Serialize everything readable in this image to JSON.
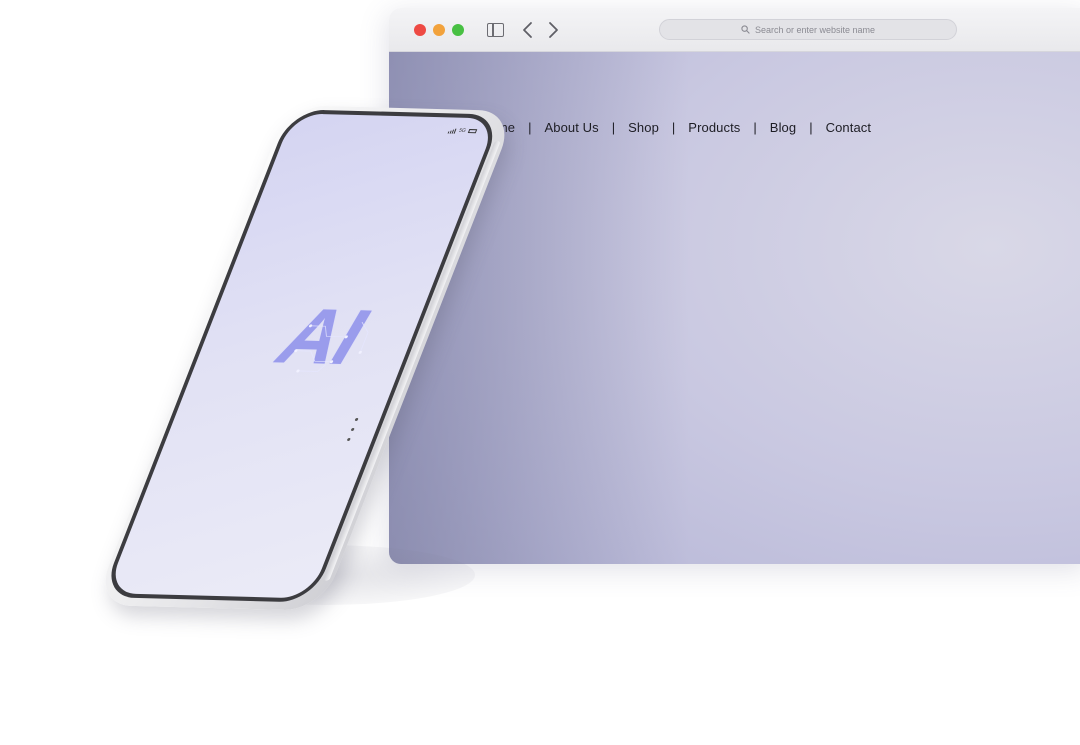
{
  "browser": {
    "address_bar": {
      "placeholder": "Search or enter website name",
      "icon": "search-icon"
    },
    "window_controls": {
      "close_color": "#ee4a44",
      "minimize_color": "#f2a23c",
      "maximize_color": "#48c043"
    },
    "toolbar_icons": [
      "sidebar-toggle-icon",
      "back-arrow-icon",
      "forward-arrow-icon"
    ]
  },
  "site": {
    "menu_icon": "hamburger-icon",
    "nav": {
      "home": "Home",
      "about": "About Us",
      "shop": "Shop",
      "products": "Products",
      "blog": "Blog",
      "contact": "Contact",
      "separator": "|"
    }
  },
  "phone": {
    "screen_text": "AI",
    "status_network": "5G",
    "status_icons": [
      "signal-icon",
      "battery-icon"
    ],
    "accent_color": "#9a9cec"
  }
}
